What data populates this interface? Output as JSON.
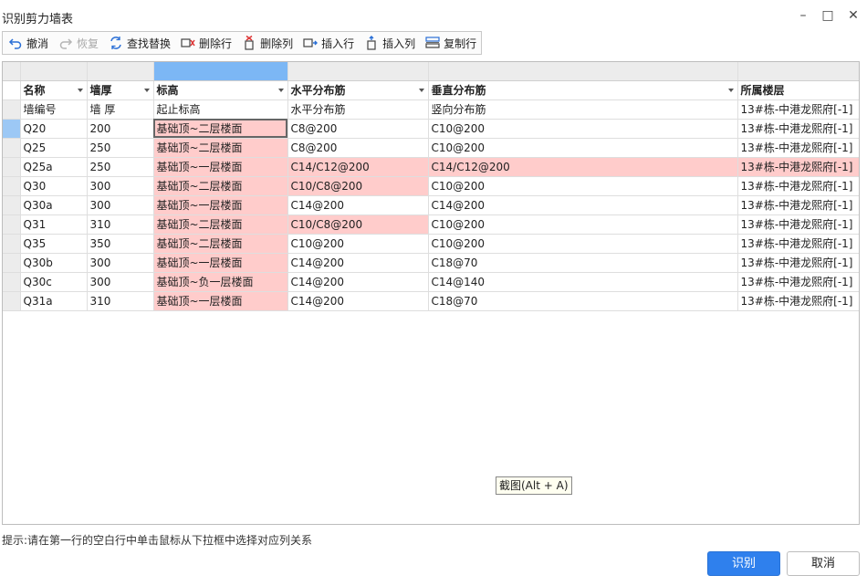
{
  "window": {
    "title": "识别剪力墙表"
  },
  "toolbar": {
    "undo": "撤消",
    "redo": "恢复",
    "find_replace": "查找替换",
    "delete_row": "删除行",
    "delete_col": "删除列",
    "insert_row": "插入行",
    "insert_col": "插入列",
    "copy_row": "复制行"
  },
  "columns": [
    "名称",
    "墙厚",
    "标高",
    "水平分布筋",
    "垂直分布筋",
    "所属楼层"
  ],
  "original_headers": [
    "墙编号",
    "墙 厚",
    "起止标高",
    "水平分布筋",
    "竖向分布筋",
    "13#栋-中港龙熙府[-1]"
  ],
  "rows": [
    [
      "Q20",
      "200",
      "基础顶~二层楼面",
      "C8@200",
      "C10@200",
      "13#栋-中港龙熙府[-1]"
    ],
    [
      "Q25",
      "250",
      "基础顶~二层楼面",
      "C8@200",
      "C10@200",
      "13#栋-中港龙熙府[-1]"
    ],
    [
      "Q25a",
      "250",
      "基础顶~一层楼面",
      "C14/C12@200",
      "C14/C12@200",
      "13#栋-中港龙熙府[-1]"
    ],
    [
      "Q30",
      "300",
      "基础顶~二层楼面",
      "C10/C8@200",
      "C10@200",
      "13#栋-中港龙熙府[-1]"
    ],
    [
      "Q30a",
      "300",
      "基础顶~一层楼面",
      "C14@200",
      "C14@200",
      "13#栋-中港龙熙府[-1]"
    ],
    [
      "Q31",
      "310",
      "基础顶~二层楼面",
      "C10/C8@200",
      "C10@200",
      "13#栋-中港龙熙府[-1]"
    ],
    [
      "Q35",
      "350",
      "基础顶~二层楼面",
      "C10@200",
      "C10@200",
      "13#栋-中港龙熙府[-1]"
    ],
    [
      "Q30b",
      "300",
      "基础顶~一层楼面",
      "C14@200",
      "C18@70",
      "13#栋-中港龙熙府[-1]"
    ],
    [
      "Q30c",
      "300",
      "基础顶~负一层楼面",
      "C14@200",
      "C14@140",
      "13#栋-中港龙熙府[-1]"
    ],
    [
      "Q31a",
      "310",
      "基础顶~一层楼面",
      "C14@200",
      "C18@70",
      "13#栋-中港龙熙府[-1]"
    ]
  ],
  "highlighted_cells": [
    [
      0,
      2
    ],
    [
      1,
      2
    ],
    [
      2,
      2
    ],
    [
      2,
      3
    ],
    [
      2,
      4
    ],
    [
      2,
      5
    ],
    [
      3,
      2
    ],
    [
      3,
      3
    ],
    [
      4,
      2
    ],
    [
      5,
      2
    ],
    [
      5,
      3
    ],
    [
      6,
      2
    ],
    [
      7,
      2
    ],
    [
      8,
      2
    ],
    [
      9,
      2
    ]
  ],
  "tooltip": "截图(Alt + A)",
  "hint": "提示:请在第一行的空白行中单击鼠标从下拉框中选择对应列关系",
  "buttons": {
    "recognize": "识别",
    "cancel": "取消"
  },
  "colors": {
    "highlight": "#ffcccb",
    "accent": "#2f80ed",
    "selected_column": "#7cb7f5"
  }
}
